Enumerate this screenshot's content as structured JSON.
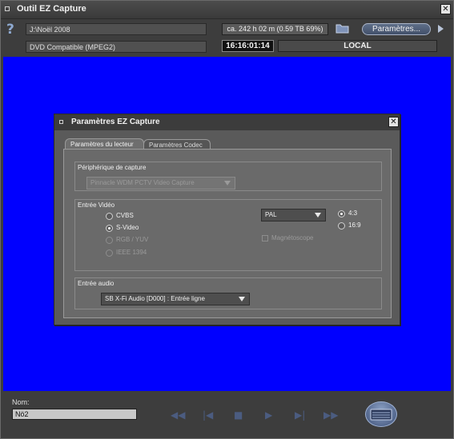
{
  "window": {
    "title": "Outil EZ Capture",
    "close_symbol": "✕"
  },
  "header": {
    "path": "J:\\Noël 2008",
    "status": "ca. 242 h 02 m  (0.59 TB  69%)",
    "params_button": "Paramètres...",
    "format": "DVD Compatible  (MPEG2)",
    "timecode": "16:16:01:14",
    "source": "LOCAL"
  },
  "dialog": {
    "title": "Paramètres EZ Capture",
    "close_symbol": "✕",
    "tabs": [
      {
        "label": "Paramètres du lecteur",
        "active": true
      },
      {
        "label": "Paramètres Codec",
        "active": false
      }
    ],
    "capture_device": {
      "label": "Périphérique de capture",
      "value": "Pinnacle WDM PCTV Video Capture"
    },
    "video_input": {
      "label": "Entrée Vidéo",
      "options": [
        {
          "label": "CVBS",
          "selected": false,
          "enabled": true
        },
        {
          "label": "S-Video",
          "selected": true,
          "enabled": true
        },
        {
          "label": "RGB / YUV",
          "selected": false,
          "enabled": false
        },
        {
          "label": "IEEE 1394",
          "selected": false,
          "enabled": false
        }
      ],
      "standard": "PAL",
      "aspect": [
        {
          "label": "4:3",
          "selected": true
        },
        {
          "label": "16:9",
          "selected": false
        }
      ],
      "vcr_checkbox": {
        "label": "Magnétoscope",
        "checked": false,
        "enabled": false
      }
    },
    "audio_input": {
      "label": "Entrée audio",
      "value": "SB X-Fi Audio [D000] : Entrée ligne"
    }
  },
  "footer": {
    "name_label": "Nom:",
    "name_value": "Nö2",
    "transport": {
      "rewind": "◀◀",
      "step_back": "|◀",
      "stop": "■",
      "play": "▶",
      "step_forward": "▶|",
      "fast_forward": "▶▶"
    }
  },
  "colors": {
    "preview": "#0000ff",
    "chrome": "#3d3d3d",
    "accent": "#5e6e88"
  }
}
